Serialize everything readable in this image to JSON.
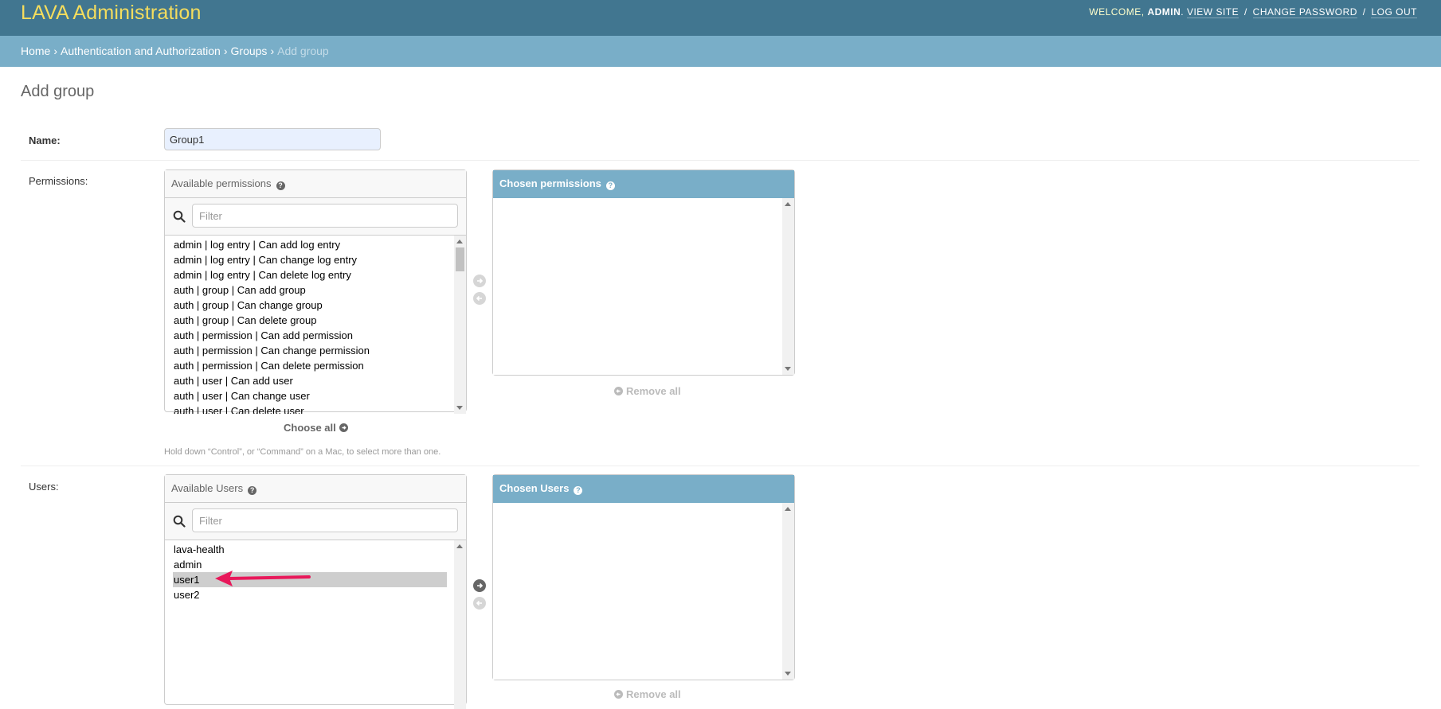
{
  "header": {
    "branding": "LAVA Administration",
    "welcome": "WELCOME,",
    "user": "ADMIN",
    "links": {
      "view_site": "VIEW SITE",
      "change_password": "CHANGE PASSWORD",
      "logout": "LOG OUT"
    },
    "separator": "/"
  },
  "breadcrumbs": {
    "items": [
      "Home",
      "Authentication and Authorization",
      "Groups"
    ],
    "current": "Add group",
    "separator": "›"
  },
  "page": {
    "title": "Add group"
  },
  "form": {
    "name_label": "Name:",
    "name_value": "Group1",
    "permissions_label": "Permissions:",
    "users_label": "Users:",
    "help_text": "Hold down “Control”, or “Command” on a Mac, to select more than one."
  },
  "permissions": {
    "available_title": "Available permissions",
    "chosen_title": "Chosen permissions",
    "filter_placeholder": "Filter",
    "choose_all": "Choose all",
    "remove_all": "Remove all",
    "options": [
      "admin | log entry | Can add log entry",
      "admin | log entry | Can change log entry",
      "admin | log entry | Can delete log entry",
      "auth | group | Can add group",
      "auth | group | Can change group",
      "auth | group | Can delete group",
      "auth | permission | Can add permission",
      "auth | permission | Can change permission",
      "auth | permission | Can delete permission",
      "auth | user | Can add user",
      "auth | user | Can change user",
      "auth | user | Can delete user"
    ]
  },
  "users": {
    "available_title": "Available Users",
    "chosen_title": "Chosen Users",
    "filter_placeholder": "Filter",
    "remove_all": "Remove all",
    "options": [
      "lava-health",
      "admin",
      "user1",
      "user2"
    ],
    "selected": "user1"
  },
  "colors": {
    "header_bg": "#417690",
    "branding": "#f5dd5d",
    "breadcrumb_bg": "#79aec8",
    "annotation_arrow": "#e8185a"
  }
}
